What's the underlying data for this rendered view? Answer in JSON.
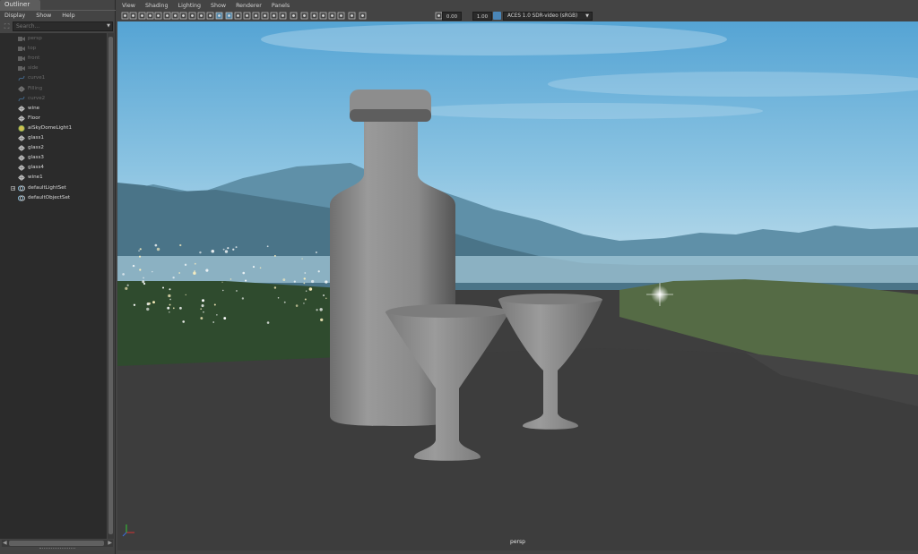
{
  "outliner": {
    "tab_label": "Outliner",
    "menu": [
      "Display",
      "Show",
      "Help"
    ],
    "search_placeholder": "Search...",
    "items": [
      {
        "label": "persp",
        "icon": "camera-icon",
        "dim": true
      },
      {
        "label": "top",
        "icon": "camera-icon",
        "dim": true
      },
      {
        "label": "front",
        "icon": "camera-icon",
        "dim": true
      },
      {
        "label": "side",
        "icon": "camera-icon",
        "dim": true
      },
      {
        "label": "curve1",
        "icon": "curve-icon",
        "dim": true
      },
      {
        "label": "Filling",
        "icon": "mesh-icon",
        "dim": true
      },
      {
        "label": "curve2",
        "icon": "curve-icon",
        "dim": true
      },
      {
        "label": "wine",
        "icon": "mesh-icon",
        "dim": false
      },
      {
        "label": "Floor",
        "icon": "mesh-icon",
        "dim": false
      },
      {
        "label": "aiSkyDomeLight1",
        "icon": "skydome-light-icon",
        "dim": false
      },
      {
        "label": "glass1",
        "icon": "mesh-icon",
        "dim": false
      },
      {
        "label": "glass2",
        "icon": "mesh-icon",
        "dim": false
      },
      {
        "label": "glass3",
        "icon": "mesh-icon",
        "dim": false
      },
      {
        "label": "glass4",
        "icon": "mesh-icon",
        "dim": false
      },
      {
        "label": "wine1",
        "icon": "mesh-icon",
        "dim": false
      },
      {
        "label": "defaultLightSet",
        "icon": "set-icon",
        "dim": false,
        "expandable": true
      },
      {
        "label": "defaultObjectSet",
        "icon": "set-icon",
        "dim": false
      }
    ]
  },
  "panel": {
    "menu": [
      "View",
      "Shading",
      "Lighting",
      "Show",
      "Renderer",
      "Panels"
    ],
    "exposure": "0.00",
    "gamma": "1.00",
    "color_space": "ACES 1.0 SDR-video (sRGB)",
    "camera": "persp"
  },
  "colors": {
    "ui_bg": "#444444",
    "ui_dark": "#2b2b2b",
    "sky_top": "#5fa9d6",
    "floor": "#3e3e3e",
    "model_grey": "#8c8c8c"
  }
}
